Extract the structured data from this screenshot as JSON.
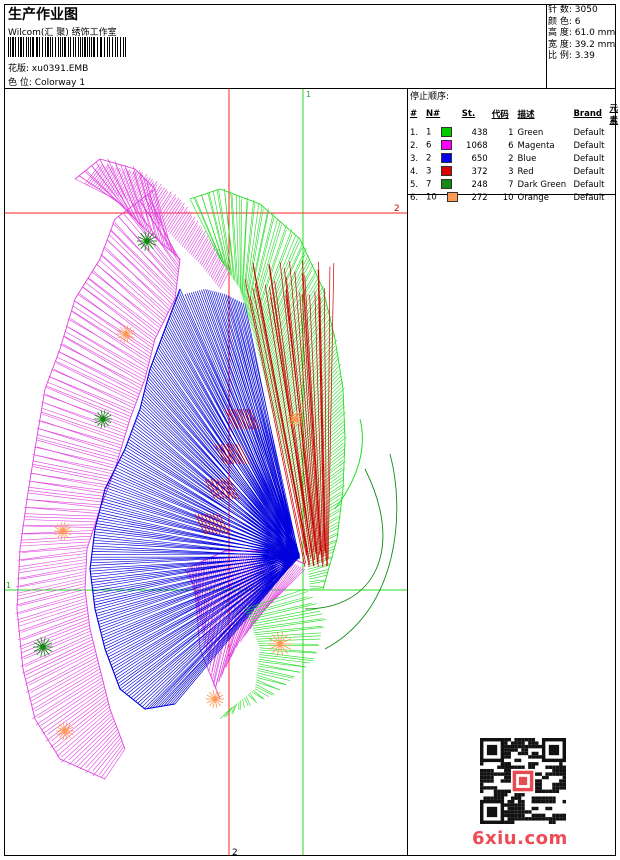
{
  "header": {
    "title": "生产作业图",
    "company": "Wilcom(汇 聚) 绣饰工作室",
    "design_label": "花版:",
    "design_value": "xu0391.EMB",
    "colorway_label": "色 位:",
    "colorway_value": "Colorway 1"
  },
  "stats": {
    "stitches_label": "针 数:",
    "stitches_value": "3050",
    "colors_label": "颜 色:",
    "colors_value": "6",
    "height_label": "高 度:",
    "height_value": "61.0 mm",
    "width_label": "宽 度:",
    "width_value": "39.2 mm",
    "scale_label": "比 例:",
    "scale_value": "3.39"
  },
  "sequence": {
    "title": "停止顺序:",
    "headers": [
      "#",
      "N#",
      "St.",
      "代码",
      "描述",
      "Brand",
      "元素"
    ],
    "rows": [
      {
        "idx": "1.",
        "n": "1",
        "color": "#00cc00",
        "st": "438",
        "code": "1",
        "desc": "Green",
        "brand": "Default"
      },
      {
        "idx": "2.",
        "n": "6",
        "color": "#ff00ff",
        "st": "1068",
        "code": "6",
        "desc": "Magenta",
        "brand": "Default"
      },
      {
        "idx": "3.",
        "n": "2",
        "color": "#0000ee",
        "st": "650",
        "code": "2",
        "desc": "Blue",
        "brand": "Default"
      },
      {
        "idx": "4.",
        "n": "3",
        "color": "#dd0000",
        "st": "372",
        "code": "3",
        "desc": "Red",
        "brand": "Default"
      },
      {
        "idx": "5.",
        "n": "7",
        "color": "#138a13",
        "st": "248",
        "code": "7",
        "desc": "Dark Green",
        "brand": "Default"
      },
      {
        "idx": "6.",
        "n": "10",
        "color": "#ff9b55",
        "st": "272",
        "code": "10",
        "desc": "Orange",
        "brand": "Default"
      }
    ]
  },
  "guides": {
    "v_green": "1",
    "h_red": "2",
    "h_green": "1",
    "v_red": "2"
  },
  "watermark": "6xiu.com",
  "colors": {
    "green": "#22dd22",
    "magenta": "#e040e0",
    "blue": "#0000dd",
    "red": "#cc0000",
    "dark_green": "#138a13",
    "orange": "#ff9b55"
  }
}
